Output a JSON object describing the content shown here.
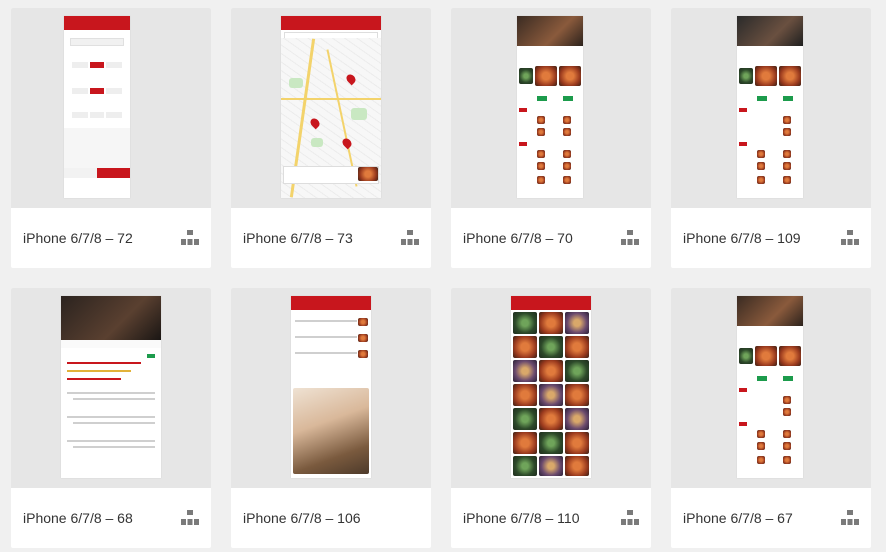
{
  "artboards": [
    {
      "label": "iPhone 6/7/8 – 72",
      "icon": "flow-icon",
      "kind": "filter"
    },
    {
      "label": "iPhone 6/7/8 – 73",
      "icon": "flow-icon",
      "kind": "map"
    },
    {
      "label": "iPhone 6/7/8 – 70",
      "icon": "flow-icon",
      "kind": "menu"
    },
    {
      "label": "iPhone 6/7/8 – 109",
      "icon": "flow-icon",
      "kind": "menu"
    },
    {
      "label": "iPhone 6/7/8 – 68",
      "icon": "flow-icon",
      "kind": "reviews"
    },
    {
      "label": "iPhone 6/7/8 – 106",
      "icon": "flow-icon",
      "kind": "list-photo"
    },
    {
      "label": "iPhone 6/7/8 – 110",
      "icon": "flow-icon",
      "kind": "gallery"
    },
    {
      "label": "iPhone 6/7/8 – 67",
      "icon": "flow-icon",
      "kind": "menu"
    }
  ],
  "colors": {
    "brand_red": "#c8161d",
    "accent_green": "#1c9b4c",
    "page_bg": "#f0f0f0",
    "label_text": "#333333"
  }
}
